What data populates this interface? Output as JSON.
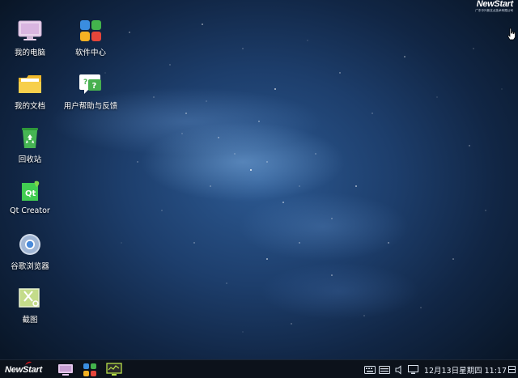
{
  "desktop": {
    "icons": [
      {
        "label": "我的电脑",
        "icon": "computer-icon"
      },
      {
        "label": "软件中心",
        "icon": "software-center-icon"
      },
      {
        "label": "我的文档",
        "icon": "documents-folder-icon"
      },
      {
        "label": "用户帮助与反馈",
        "icon": "help-feedback-icon"
      },
      {
        "label": "回收站",
        "icon": "recycle-bin-icon"
      },
      {
        "label": "Qt Creator",
        "icon": "qt-creator-icon"
      },
      {
        "label": "谷歌浏览器",
        "icon": "chrome-browser-icon"
      },
      {
        "label": "截图",
        "icon": "screenshot-icon"
      }
    ]
  },
  "brand": {
    "name": "NewStart",
    "subtitle": "广东中兴新支点技术有限公司"
  },
  "taskbar": {
    "start_label": "NewStart",
    "apps": [
      "computer-icon",
      "software-center-icon",
      "system-monitor-icon"
    ],
    "tray": [
      "keyboard-icon",
      "input-method-icon",
      "volume-icon",
      "display-icon"
    ],
    "clock": "12月13日星期四 11:17"
  },
  "colors": {
    "taskbar_bg": "#0c121b",
    "desktop_center": "#2d5a93",
    "desktop_edge": "#091627",
    "brand_accent": "#d0141b"
  }
}
